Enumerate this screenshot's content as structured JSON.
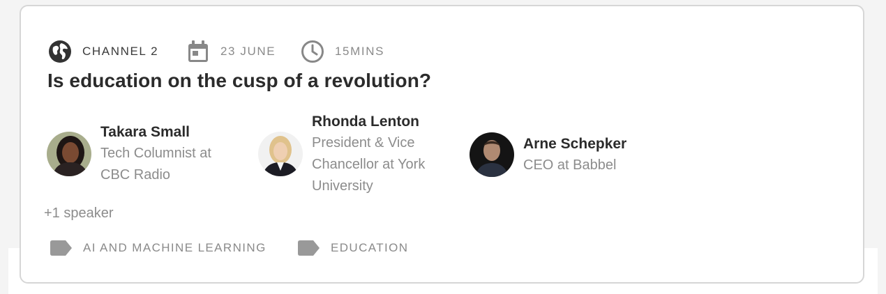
{
  "event": {
    "channel": "CHANNEL 2",
    "date": "23 JUNE",
    "duration": "15MINS",
    "title": "Is education on the cusp of a revolution?",
    "icons": {
      "channel": "globe-icon",
      "date": "calendar-icon",
      "duration": "clock-icon",
      "tag": "tag-icon"
    }
  },
  "speakers": [
    {
      "name": "Takara Small",
      "role_lines": [
        "Tech Columnist at",
        "CBC Radio"
      ]
    },
    {
      "name": "Rhonda Lenton",
      "role_lines": [
        "President & Vice",
        "Chancellor at York",
        "University"
      ]
    },
    {
      "name": "Arne Schepker",
      "role_lines": [
        "CEO at Babbel"
      ]
    }
  ],
  "more_speakers": "+1 speaker",
  "tags": [
    "AI AND MACHINE LEARNING",
    "EDUCATION"
  ],
  "colors": {
    "title_text": "#2b2b2b",
    "muted_text": "#8a8a8a",
    "card_border": "#d6d6d6",
    "tag_icon": "#999999"
  }
}
